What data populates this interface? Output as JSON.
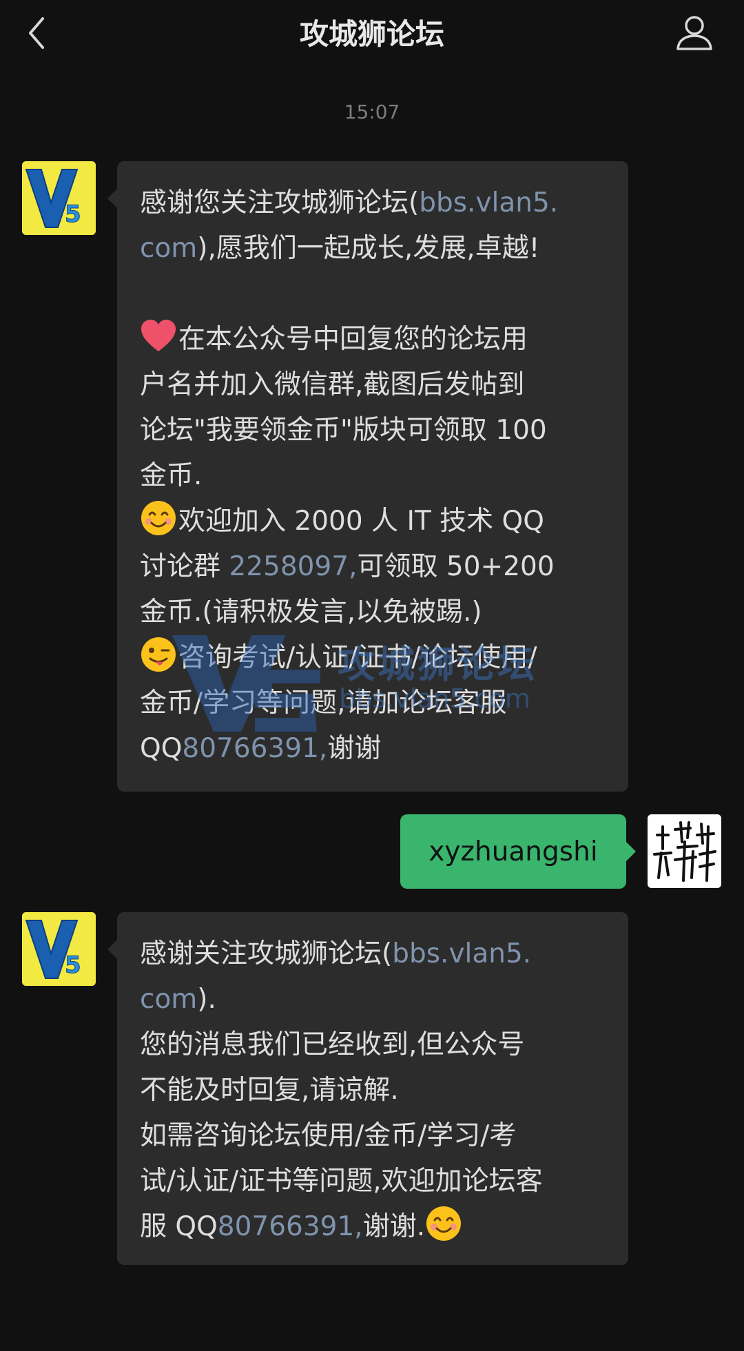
{
  "header": {
    "title": "攻城狮论坛"
  },
  "time_label": "15:07",
  "avatars": {
    "official_text": "V5",
    "user_text": "林"
  },
  "message1": {
    "l1a": "感谢您关注攻城狮论坛(",
    "l1b": "bbs.vlan5.",
    "l2a": "com",
    "l2b": "),愿我们一起成长,发展,卓越!",
    "l4": "在本公众号中回复您的论坛用",
    "l5": "户名并加入微信群,截图后发帖到",
    "l6": "论坛\"我要领金币\"版块可领取 100",
    "l7": "金币.",
    "l8": "欢迎加入 2000 人 IT 技术 QQ",
    "l9a": "讨论群 ",
    "l9b": "2258097,",
    "l9c": "可领取 50+200",
    "l10": "金币.(请积极发言,以免被踢.)",
    "l11": "咨询考试/认证/证书/论坛使用/",
    "l12": "金币/学习等问题,请加论坛客服",
    "l13a": "QQ",
    "l13b": "80766391,",
    "l13c": "谢谢"
  },
  "reply": {
    "text": "xyzhuangshi"
  },
  "message2": {
    "l1a": "感谢关注攻城狮论坛(",
    "l1b": "bbs.vlan5.",
    "l2a": "com",
    "l2b": ").",
    "l3": "您的消息我们已经收到,但公众号",
    "l4": "不能及时回复,请谅解.",
    "l5": "如需咨询论坛使用/金币/学习/考",
    "l6": "试/认证/证书等问题,欢迎加论坛客",
    "l7a": "服 QQ",
    "l7b": "80766391,",
    "l7c": "谢谢."
  },
  "watermark": {
    "title": "攻城狮论坛",
    "url": "bbs.vlan5.com"
  },
  "icons": [
    "back-arrow-icon",
    "profile-icon",
    "heart-icon",
    "smile-emoji-icon",
    "wink-emoji-icon"
  ],
  "colors": {
    "background": "#111111",
    "bubble_left": "#2c2c2c",
    "bubble_right": "#39b56e",
    "link": "#7f93ad"
  }
}
